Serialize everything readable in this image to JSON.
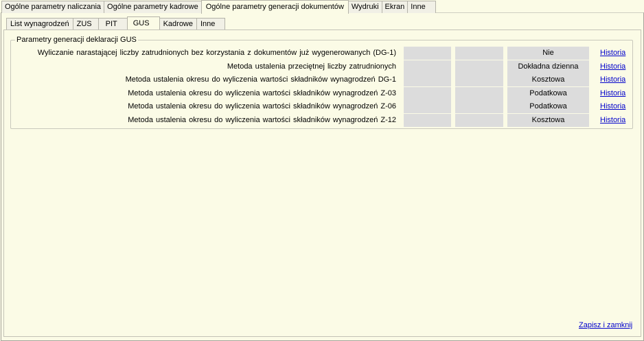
{
  "top_tabs": [
    {
      "label": "Ogólne parametry naliczania"
    },
    {
      "label": "Ogólne parametry kadrowe"
    },
    {
      "label": "Ogólne parametry generacji dokumentów"
    },
    {
      "label": "Wydruki"
    },
    {
      "label": "Ekran"
    },
    {
      "label": "Inne"
    }
  ],
  "sub_tabs": [
    {
      "label": "List wynagrodzeń"
    },
    {
      "label": "ZUS"
    },
    {
      "label": "PIT"
    },
    {
      "label": "GUS"
    },
    {
      "label": "Kadrowe"
    },
    {
      "label": "Inne"
    }
  ],
  "group": {
    "title": "Parametry generacji deklaracji GUS",
    "rows": [
      {
        "label": "Wyliczanie narastającej liczby zatrudnionych bez korzystania z dokumentów już wygenerowanych (DG-1)",
        "value": "Nie",
        "link": "Historia"
      },
      {
        "label": "Metoda ustalenia przeciętnej liczby zatrudnionych",
        "value": "Dokładna dzienna",
        "link": "Historia"
      },
      {
        "label": "Metoda ustalenia okresu do wyliczenia wartości składników wynagrodzeń DG-1",
        "value": "Kosztowa",
        "link": "Historia"
      },
      {
        "label": "Metoda ustalenia okresu do wyliczenia wartości składników wynagrodzeń Z-03",
        "value": "Podatkowa",
        "link": "Historia"
      },
      {
        "label": "Metoda ustalenia okresu do wyliczenia wartości składników wynagrodzeń Z-06",
        "value": "Podatkowa",
        "link": "Historia"
      },
      {
        "label": "Metoda ustalenia okresu do wyliczenia wartości składników wynagrodzeń Z-12",
        "value": "Kosztowa",
        "link": "Historia"
      }
    ]
  },
  "save_label": "Zapisz i zamknij"
}
